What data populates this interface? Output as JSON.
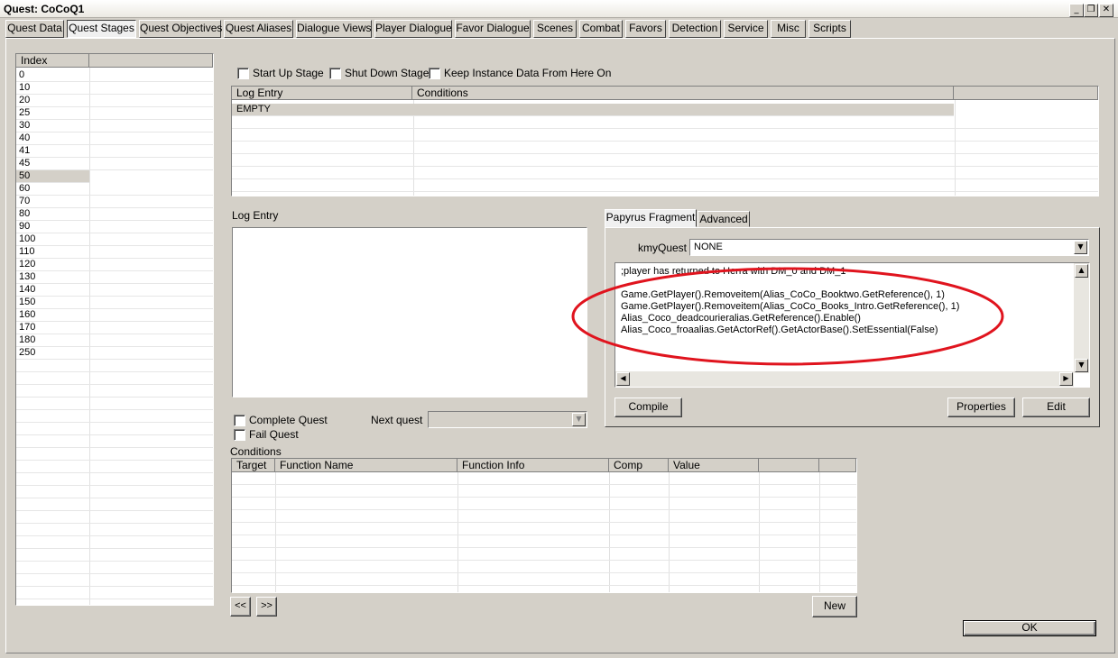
{
  "window": {
    "title": "Quest: CoCoQ1",
    "minimize_label": "_",
    "restore_label": "❐",
    "close_label": "✕"
  },
  "tabs": [
    {
      "label": "Quest Data"
    },
    {
      "label": "Quest Stages"
    },
    {
      "label": "Quest Objectives"
    },
    {
      "label": "Quest Aliases"
    },
    {
      "label": "Dialogue Views"
    },
    {
      "label": "Player Dialogue"
    },
    {
      "label": "Favor Dialogue"
    },
    {
      "label": "Scenes"
    },
    {
      "label": "Combat"
    },
    {
      "label": "Favors"
    },
    {
      "label": "Detection"
    },
    {
      "label": "Service"
    },
    {
      "label": "Misc"
    },
    {
      "label": "Scripts"
    }
  ],
  "active_tab": "Quest Stages",
  "stages": {
    "header": "Index",
    "items": [
      "0",
      "10",
      "20",
      "25",
      "30",
      "40",
      "41",
      "45",
      "50",
      "60",
      "70",
      "80",
      "90",
      "100",
      "110",
      "120",
      "130",
      "140",
      "150",
      "160",
      "170",
      "180",
      "250"
    ],
    "selected": "50"
  },
  "stage_flags": {
    "startup": "Start Up Stage",
    "shutdown": "Shut Down Stage",
    "keep_instance": "Keep Instance Data From Here On"
  },
  "log_table": {
    "headers": [
      "Log Entry",
      "Conditions"
    ],
    "rows": [
      [
        "EMPTY",
        ""
      ]
    ]
  },
  "log_entry_label": "Log Entry",
  "quest_options": {
    "complete": "Complete Quest",
    "fail": "Fail Quest",
    "next_quest_label": "Next quest"
  },
  "fragment": {
    "tabs": [
      "Papyrus Fragment",
      "Advanced"
    ],
    "property_label": "kmyQuest",
    "property_value": "NONE",
    "code_lines": [
      ";player has returned to Herra with DM_0 and DM_1",
      "",
      "Game.GetPlayer().Removeitem(Alias_CoCo_Booktwo.GetReference(), 1)",
      "Game.GetPlayer().Removeitem(Alias_CoCo_Books_Intro.GetReference(), 1)",
      "Alias_Coco_deadcourieralias.GetReference().Enable()",
      "Alias_Coco_froaalias.GetActorRef().GetActorBase().SetEssential(False)"
    ],
    "compile_label": "Compile",
    "properties_label": "Properties",
    "edit_label": "Edit"
  },
  "conditions": {
    "label": "Conditions",
    "headers": [
      "Target",
      "Function Name",
      "Function Info",
      "Comp",
      "Value",
      ""
    ],
    "prev_label": "<<",
    "next_label": ">>",
    "new_label": "New"
  },
  "ok_label": "OK",
  "annotation_color": "#e0141e"
}
